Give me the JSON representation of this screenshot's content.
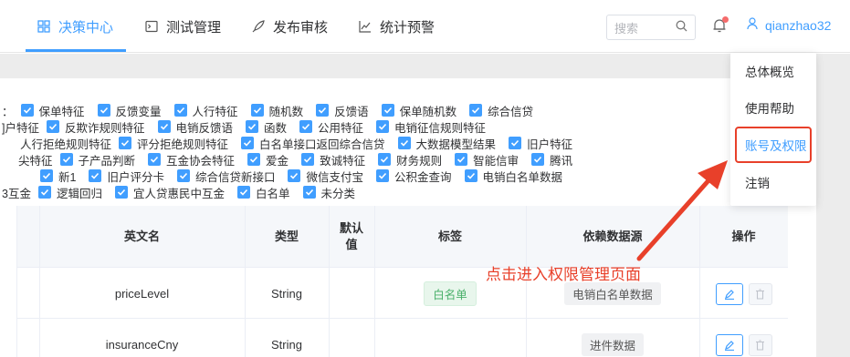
{
  "nav": {
    "tabs": [
      {
        "label": "决策中心",
        "icon": "grid-icon"
      },
      {
        "label": "测试管理",
        "icon": "terminal-icon"
      },
      {
        "label": "发布审核",
        "icon": "rocket-icon"
      },
      {
        "label": "统计预警",
        "icon": "line-chart-icon"
      }
    ],
    "search_placeholder": "搜索",
    "username": "qianzhao32"
  },
  "checkbox_rows": [
    {
      "lead": "：",
      "items": [
        "保单特征",
        "反馈变量",
        "人行特征",
        "随机数",
        "反馈语",
        "保单随机数",
        "综合信贷"
      ]
    },
    {
      "lead": "]户特征",
      "items": [
        "反欺诈规则特征",
        "电销反馈语",
        "函数",
        "公用特征",
        "电销征信规则特征"
      ]
    },
    {
      "lead": "人行拒绝规则特征",
      "items": [
        "评分拒绝规则特征",
        "白名单接口返回综合信贷",
        "大数据模型结果",
        "旧户特征"
      ]
    },
    {
      "lead": "尖特征",
      "items": [
        "子产品判断",
        "互金协会特征",
        "爱金",
        "致诚特征",
        "财务规则",
        "智能信审",
        "腾讯"
      ]
    },
    {
      "lead": "",
      "items": [
        "新1",
        "旧户评分卡",
        "综合信贷新接口",
        "微信支付宝",
        "公积金查询",
        "电销白名单数据"
      ]
    },
    {
      "lead": "3互金",
      "items": [
        "逻辑回归",
        "宜人贷惠民中互金",
        "白名单",
        "未分类"
      ]
    }
  ],
  "table": {
    "headers": [
      "",
      "英文名",
      "类型",
      "默认值",
      "标签",
      "依赖数据源",
      "操作"
    ],
    "rows": [
      {
        "name": "priceLevel",
        "type": "String",
        "default": "",
        "tag": "白名单",
        "source": "电销白名单数据"
      },
      {
        "name": "insuranceCny",
        "type": "String",
        "default": "",
        "tag": "",
        "source": "进件数据"
      }
    ]
  },
  "menu": {
    "items": [
      "总体概览",
      "使用帮助",
      "账号及权限",
      "注销"
    ]
  },
  "annotation": "点击进入权限管理页面",
  "colors": {
    "accent": "#409eff",
    "annotation": "#e8402a",
    "tag_green": "#49b06a"
  }
}
